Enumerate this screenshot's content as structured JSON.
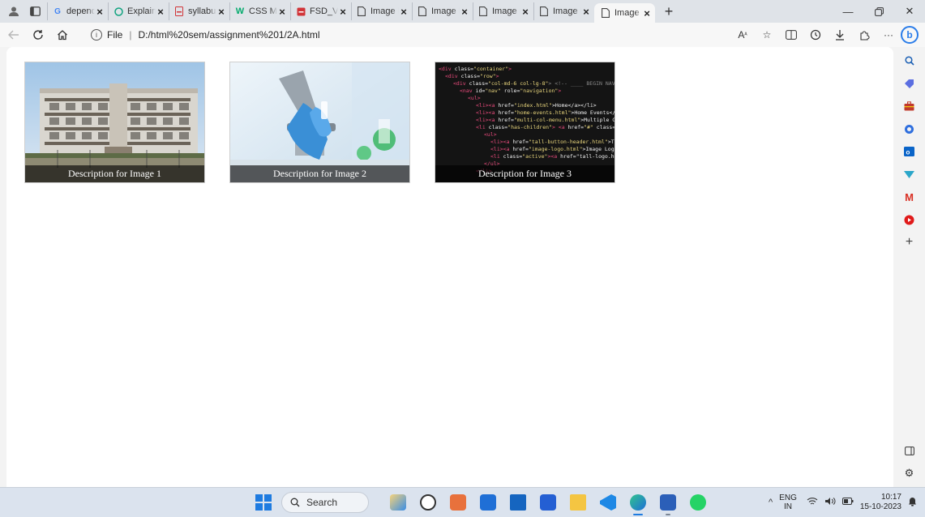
{
  "tabs": [
    {
      "label": "dependent",
      "favicon": "google-icon",
      "active": false
    },
    {
      "label": "Explaining",
      "favicon": "chatgpt-icon",
      "active": false
    },
    {
      "label": "syllabus.pd",
      "favicon": "pdf-icon",
      "active": false
    },
    {
      "label": "CSS Media",
      "favicon": "w3schools-icon",
      "active": false
    },
    {
      "label": "FSD_Vsem",
      "favicon": "pdf-icon",
      "active": false
    },
    {
      "label": "Image Hov",
      "favicon": "page-icon",
      "active": false
    },
    {
      "label": "Image Hov",
      "favicon": "page-icon",
      "active": false
    },
    {
      "label": "Image Hov",
      "favicon": "page-icon",
      "active": false
    },
    {
      "label": "Image Hov",
      "favicon": "page-icon",
      "active": false
    },
    {
      "label": "Image Hov",
      "favicon": "page-icon",
      "active": true
    }
  ],
  "toolbar": {
    "address_prefix": "File",
    "url": "D:/html%20sem/assignment%201/2A.html"
  },
  "gallery": [
    {
      "caption": "Description for Image 1",
      "image": "college-building"
    },
    {
      "caption": "Description for Image 2",
      "image": "lab-microscope"
    },
    {
      "caption": "Description for Image 3",
      "image": "html-code"
    }
  ],
  "taskbar": {
    "search_label": "Search",
    "lang_line1": "ENG",
    "lang_line2": "IN",
    "time": "10:17",
    "date": "15-10-2023"
  },
  "colors": {
    "accent": "#0078d4",
    "taskbar": "#dbe3ee",
    "chrome": "#dfe3e8"
  }
}
